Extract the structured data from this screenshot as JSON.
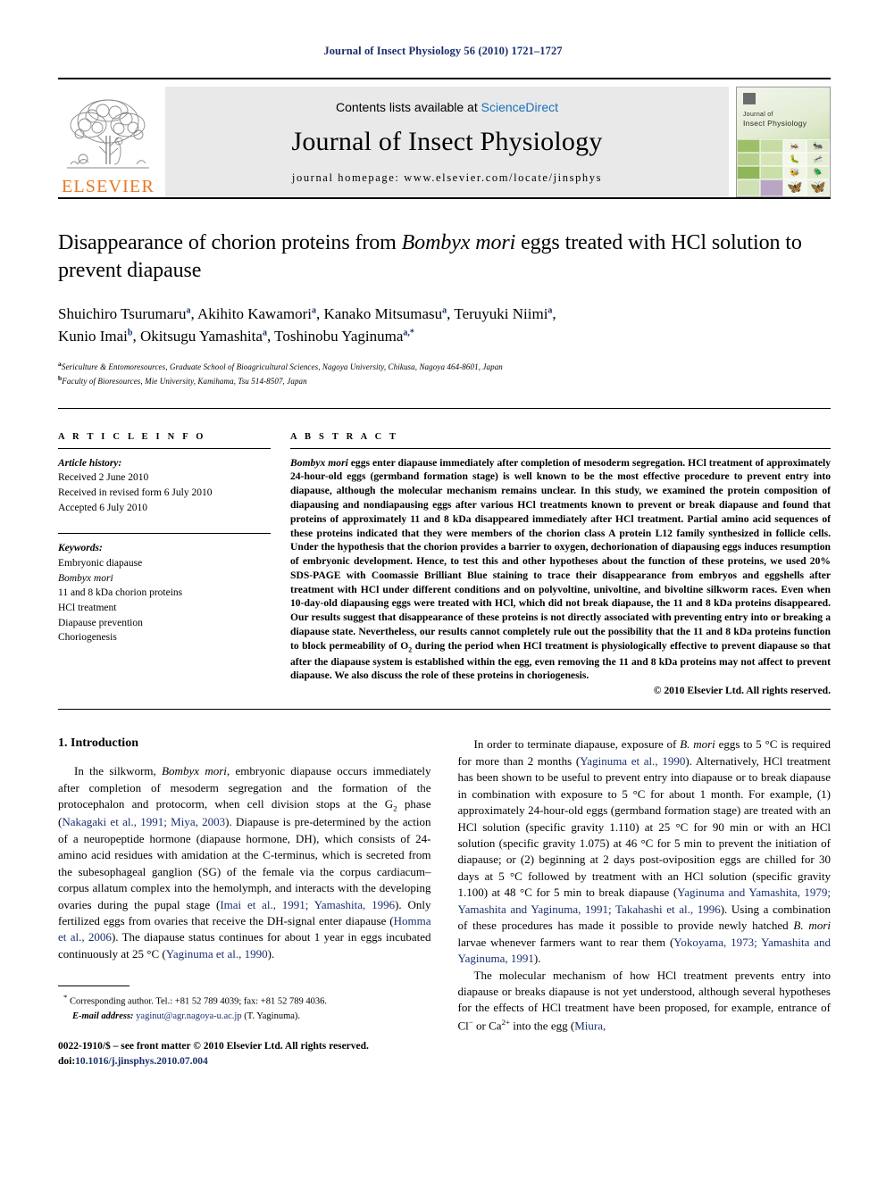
{
  "running_head": "Journal of Insect Physiology 56 (2010) 1721–1727",
  "masthead": {
    "contents_prefix": "Contents lists available at ",
    "contents_link": "ScienceDirect",
    "journal_name": "Journal of Insect Physiology",
    "homepage": "journal homepage: www.elsevier.com/locate/jinsphys",
    "publisher_logo_text": "ELSEVIER",
    "cover_line1": "Journal of",
    "cover_line2": "Insect Physiology",
    "link_color": "#1a6fba",
    "elsevier_orange": "#E87722"
  },
  "title": {
    "part1": "Disappearance of chorion proteins from ",
    "italic": "Bombyx mori",
    "part2": " eggs treated with HCl solution to prevent diapause"
  },
  "authors": {
    "line1": "Shuichiro Tsurumaru",
    "line1_sup1": "a",
    "a2": "Akihito Kawamori",
    "a2_sup": "a",
    "a3": "Kanako Mitsumasu",
    "a3_sup": "a",
    "a4": "Teruyuki Niimi",
    "a4_sup": "a",
    "a5": "Kunio Imai",
    "a5_sup": "b",
    "a6": "Okitsugu Yamashita",
    "a6_sup": "a",
    "a7": "Toshinobu Yaginuma",
    "a7_sup": "a,*"
  },
  "affiliations": [
    {
      "mark": "a",
      "text": "Sericulture & Entomoresources, Graduate School of Bioagricultural Sciences, Nagoya University, Chikusa, Nagoya 464-8601, Japan"
    },
    {
      "mark": "b",
      "text": "Faculty of Bioresources, Mie University, Kamihama, Tsu 514-8507, Japan"
    }
  ],
  "article_info": {
    "heading": "A R T I C L E  I N F O",
    "history_label": "Article history:",
    "history": [
      "Received 2 June 2010",
      "Received in revised form 6 July 2010",
      "Accepted 6 July 2010"
    ],
    "keywords_label": "Keywords:",
    "keywords": [
      "Embryonic diapause",
      "Bombyx mori",
      "11 and 8 kDa chorion proteins",
      "HCl treatment",
      "Diapause prevention",
      "Choriogenesis"
    ],
    "keyword_italic_index": 1
  },
  "abstract": {
    "heading": "A B S T R A C T",
    "lead_italic": "Bombyx mori",
    "text": " eggs enter diapause immediately after completion of mesoderm segregation. HCl treatment of approximately 24-hour-old eggs (germband formation stage) is well known to be the most effective procedure to prevent entry into diapause, although the molecular mechanism remains unclear. In this study, we examined the protein composition of diapausing and nondiapausing eggs after various HCl treatments known to prevent or break diapause and found that proteins of approximately 11 and 8 kDa disappeared immediately after HCl treatment. Partial amino acid sequences of these proteins indicated that they were members of the chorion class A protein L12 family synthesized in follicle cells. Under the hypothesis that the chorion provides a barrier to oxygen, dechorionation of diapausing eggs induces resumption of embryonic development. Hence, to test this and other hypotheses about the function of these proteins, we used 20% SDS-PAGE with Coomassie Brilliant Blue staining to trace their disappearance from embryos and eggshells after treatment with HCl under different conditions and on polyvoltine, univoltine, and bivoltine silkworm races. Even when 10-day-old diapausing eggs were treated with HCl, which did not break diapause, the 11 and 8 kDa proteins disappeared. Our results suggest that disappearance of these proteins is not directly associated with preventing entry into or breaking a diapause state. Nevertheless, our results cannot completely rule out the possibility that the 11 and 8 kDa proteins function to block permeability of O",
    "text_sub": "2",
    "text_after": " during the period when HCl treatment is physiologically effective to prevent diapause so that after the diapause system is established within the egg, even removing the 11 and 8 kDa proteins may not affect to prevent diapause. We also discuss the role of these proteins in choriogenesis.",
    "copyright": "© 2010 Elsevier Ltd. All rights reserved."
  },
  "intro": {
    "heading": "1. Introduction",
    "p1_a": "In the silkworm, ",
    "p1_italic1": "Bombyx mori",
    "p1_b": ", embryonic diapause occurs immediately after completion of mesoderm segregation and the formation of the protocephalon and protocorm, when cell division stops at the G",
    "p1_sub": "2",
    "p1_c": " phase (",
    "p1_cite1": "Nakagaki et al., 1991; Miya, 2003",
    "p1_d": "). Diapause is pre-determined by the action of a neuropeptide hormone (diapause hormone, DH), which consists of 24-amino acid residues with amidation at the C-terminus, which is secreted from the subesophageal ganglion (SG) of the female via the corpus cardiacum–corpus allatum complex into the hemolymph, and interacts with the developing ovaries during the pupal stage (",
    "p1_cite2": "Imai et al., 1991; Yamashita, 1996",
    "p1_e": "). Only fertilized eggs from ovaries that receive the DH-signal enter diapause (",
    "p1_cite3": "Homma et al., 2006",
    "p1_f": "). The diapause status continues for about 1 year in eggs incubated continuously at 25 °C (",
    "p1_cite4": "Yaginuma et al., 1990",
    "p1_g": ").",
    "p2_a": "In order to terminate diapause, exposure of ",
    "p2_italic1": "B. mori",
    "p2_b": " eggs to 5 °C is required for more than 2 months (",
    "p2_cite1": "Yaginuma et al., 1990",
    "p2_c": "). Alternatively, HCl treatment has been shown to be useful to prevent entry into diapause or to break diapause in combination with exposure to 5 °C for about 1 month. For example, (1) approximately 24-hour-old eggs (germband formation stage) are treated with an HCl solution (specific gravity 1.110) at 25 °C for 90 min or with an HCl solution (specific gravity 1.075) at 46 °C for 5 min to prevent the initiation of diapause; or (2) beginning at 2 days post-oviposition eggs are chilled for 30 days at 5 °C followed by treatment with an HCl solution (specific gravity 1.100) at 48 °C for 5 min to break diapause (",
    "p2_cite2": "Yaginuma and Yamashita, 1979; Yamashita and Yaginuma, 1991; Takahashi et al., 1996",
    "p2_d": "). Using a combination of these procedures has made it possible to provide newly hatched ",
    "p2_italic2": "B. mori",
    "p2_e": " larvae whenever farmers want to rear them (",
    "p2_cite3": "Yokoyama, 1973; Yamashita and Yaginuma, 1991",
    "p2_f": ").",
    "p3_a": "The molecular mechanism of how HCl treatment prevents entry into diapause or breaks diapause is not yet understood, although several hypotheses for the effects of HCl treatment have been proposed, for example, entrance of Cl",
    "p3_sup1": "−",
    "p3_b": " or Ca",
    "p3_sup2": "2+",
    "p3_c": " into the egg (",
    "p3_cite1": "Miura,",
    "p3_d": ""
  },
  "footer": {
    "corr_mark": "*",
    "corr_text": "Corresponding author. Tel.: +81 52 789 4039; fax: +81 52 789 4036.",
    "email_label": "E-mail address:",
    "email": "yaginut@agr.nagoya-u.ac.jp",
    "email_suffix": " (T. Yaginuma).",
    "issn": "0022-1910/$ – see front matter © 2010 Elsevier Ltd. All rights reserved.",
    "doi_label": "doi:",
    "doi": "10.1016/j.jinsphys.2010.07.004"
  }
}
